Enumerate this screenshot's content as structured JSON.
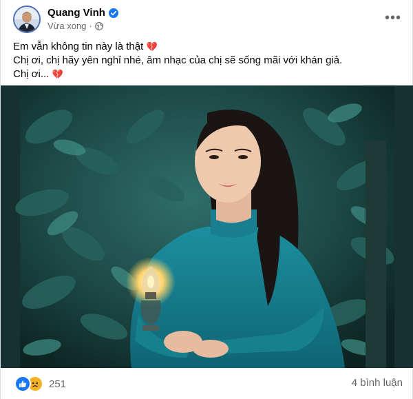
{
  "post": {
    "author": "Quang Vinh",
    "timestamp": "Vừa xong",
    "separator": "·",
    "privacy_icon": "globe-icon",
    "verified_icon": "verified-badge-icon",
    "more_icon": "more-options-icon",
    "more_label": "•••",
    "text_lines": [
      "Em vẫn không tin này là thật",
      "Chị ơi, chị hãy yên nghỉ nhé, âm nhạc của chị sẽ sống mãi với khán giả.",
      "Chị ơi..."
    ],
    "emoji": "💔"
  },
  "footer": {
    "reaction_icons": [
      "like-icon",
      "sad-icon"
    ],
    "reaction_count": "251",
    "comments_label": "4 bình luận"
  },
  "colors": {
    "accent": "#1877f2",
    "verified": "#1877f2",
    "secondary_text": "#65676b",
    "heart": "#e0245e",
    "sad": "#f7b125"
  }
}
